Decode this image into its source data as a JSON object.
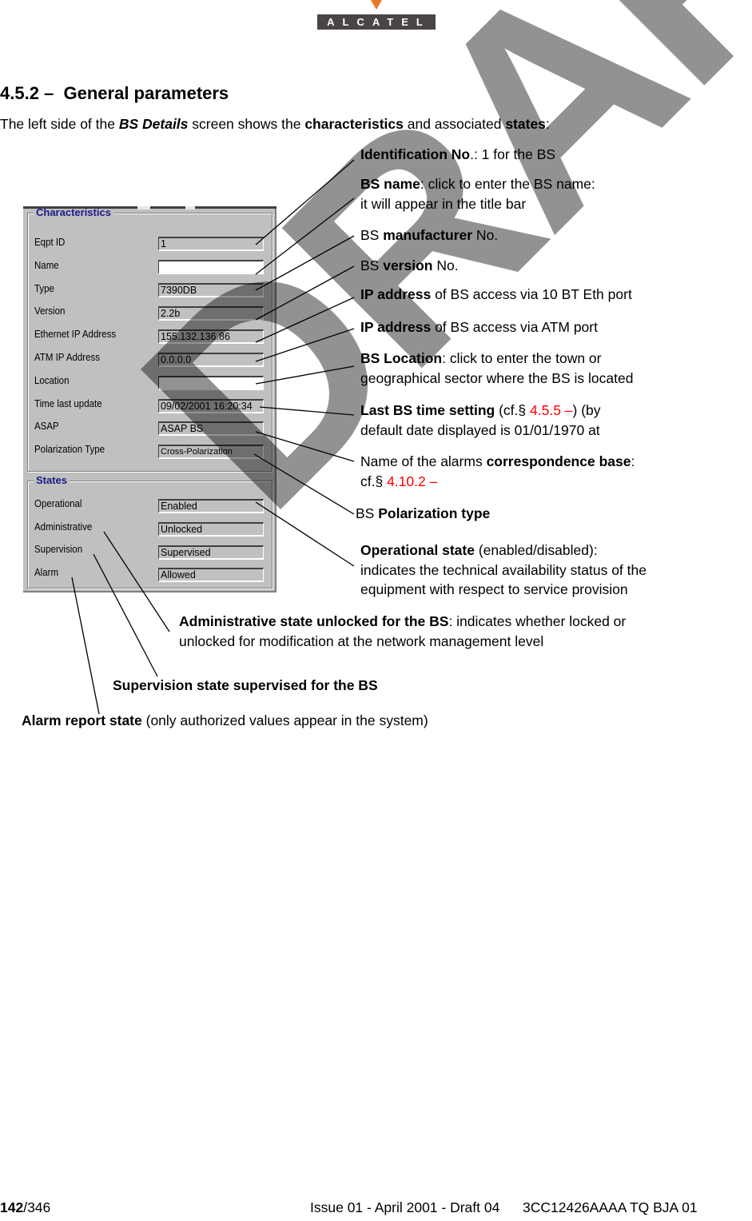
{
  "header": {
    "logo_text": "ALCATEL",
    "logo_colors": {
      "box": "#4a4444",
      "triangle": "#e87722"
    }
  },
  "section": {
    "heading": "4.5.2 –  General parameters",
    "intro": {
      "pre": "The left side of the ",
      "screen_name": "BS Details",
      "mid": " screen shows the ",
      "bold1": "characteristics",
      "mid2": " and associated ",
      "bold2": "states",
      "post": ":"
    }
  },
  "dialog": {
    "characteristics": {
      "title": "Characteristics",
      "rows": [
        {
          "label": "Eqpt ID",
          "value": "1",
          "editable": false
        },
        {
          "label": "Name",
          "value": "",
          "editable": true
        },
        {
          "label": "Type",
          "value": "7390DB",
          "editable": false
        },
        {
          "label": "Version",
          "value": "2.2b",
          "editable": false
        },
        {
          "label": "Ethernet IP Address",
          "value": "155.132.136.86",
          "editable": false
        },
        {
          "label": "ATM IP Address",
          "value": "0.0.0.0",
          "editable": false
        },
        {
          "label": "Location",
          "value": "",
          "editable": true
        },
        {
          "label": "Time last update",
          "value": "09/02/2001 16:20:34",
          "editable": false
        },
        {
          "label": "ASAP",
          "value": "ASAP BS",
          "editable": false
        },
        {
          "label": "Polarization Type",
          "value": "Cross-Polarization",
          "editable": false
        }
      ]
    },
    "states": {
      "title": "States",
      "rows": [
        {
          "label": "Operational",
          "value": "Enabled"
        },
        {
          "label": "Administrative",
          "value": "Unlocked"
        },
        {
          "label": "Supervision",
          "value": "Supervised"
        },
        {
          "label": "Alarm",
          "value": "Allowed"
        }
      ]
    }
  },
  "annotations": {
    "id": {
      "bold": "Identification No",
      "rest": ".: 1 for the BS"
    },
    "name": {
      "bold": "BS name",
      "rest": ": click to enter the BS name:",
      "line2": "it will appear in the title bar"
    },
    "manufacturer": {
      "pre": "BS ",
      "bold": "manufacturer",
      "rest": " No."
    },
    "version": {
      "pre": "BS ",
      "bold": "version",
      "rest": " No."
    },
    "eth_ip": {
      "bold": "IP address",
      "rest": " of BS access via 10 BT Eth port"
    },
    "atm_ip": {
      "bold": "IP address",
      "rest": " of BS access via ATM port"
    },
    "location": {
      "bold": "BS Location",
      "rest": ": click to enter the town or",
      "line2": "geographical sector where the BS is located"
    },
    "time": {
      "bold": "Last BS time setting",
      "pre_ref": " (cf.§ ",
      "ref": "4.5.5 –",
      "post_ref": ") (by",
      "line2": "default date displayed is 01/01/1970 at"
    },
    "asap": {
      "pre": "Name of the alarms ",
      "bold": "correspondence base",
      "rest": ":",
      "line2_pre": "cf.§ ",
      "ref": "4.10.2 –"
    },
    "polarization": {
      "pre": "BS  ",
      "bold": "Polarization type"
    },
    "operational": {
      "bold": "Operational state",
      "rest": " (enabled/disabled):",
      "line2": "indicates the technical availability status of the",
      "line3": "equipment with respect to service provision"
    },
    "administrative": {
      "bold": "Administrative state unlocked for the BS",
      "rest": ": indicates whether locked or",
      "line2": "unlocked for modification at the network management level"
    },
    "supervision": {
      "bold": "Supervision state supervised for the BS"
    },
    "alarm": {
      "bold": "Alarm report state",
      "rest": " (only authorized values appear in the system)"
    },
    "reference_color": "#ff0000"
  },
  "watermark": {
    "text": "DRAFT",
    "color": "#8c8c8c"
  },
  "footer": {
    "page_current": "142",
    "page_total": "/346",
    "issue": "Issue 01 - April 2001 - Draft 04",
    "doc_ref": "3CC12426AAAA TQ BJA 01"
  }
}
